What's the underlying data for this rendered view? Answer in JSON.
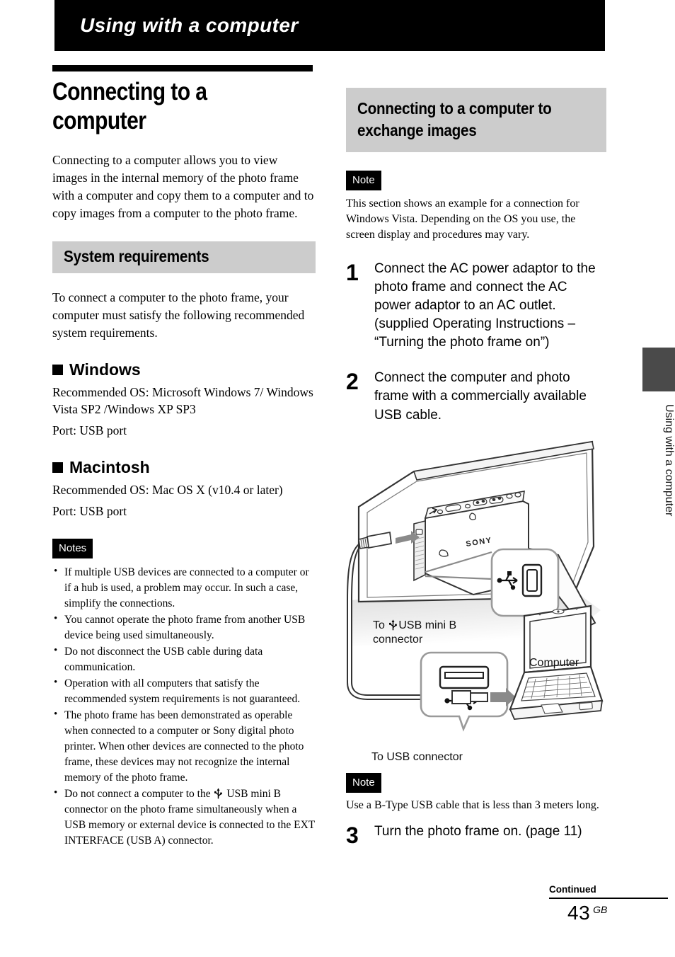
{
  "chapter": {
    "bar_title": "Using with a computer"
  },
  "left_column": {
    "article_title": "Connecting to a computer",
    "intro_paragraph": "Connecting to a computer allows you to view images in the internal memory of the photo frame with a computer and copy them to a computer and to copy images from a computer to the photo frame.",
    "system_requirements": {
      "heading": "System requirements",
      "intro": "To connect a computer to the photo frame, your computer must satisfy the following recommended system requirements.",
      "windows": {
        "heading": "Windows",
        "os_line": "Recommended OS: Microsoft Windows 7/ Windows Vista SP2 /Windows XP SP3",
        "port_line": "Port: USB port"
      },
      "macintosh": {
        "heading": "Macintosh",
        "os_line": "Recommended OS: Mac OS X (v10.4 or later)",
        "port_line": "Port: USB port"
      }
    },
    "notes": {
      "label": "Notes",
      "items": [
        {
          "text": "If multiple USB devices are connected to a computer or if a hub is used, a problem may occur. In such a case, simplify the connections."
        },
        {
          "text": "You cannot operate the photo frame from another USB device being used simultaneously."
        },
        {
          "text": "Do not disconnect the USB cable during data communication."
        },
        {
          "text": "Operation with all computers that satisfy the recommended system requirements is not guaranteed."
        },
        {
          "text": "The photo frame has been demonstrated as operable when connected to a computer or Sony digital photo printer. When other devices are connected to the photo frame, these devices may not recognize the internal memory of the photo frame."
        },
        {
          "text_before_icon": "Do not connect a computer to the ",
          "icon": "usb-trident-icon",
          "text_after_icon": " USB mini B connector on the photo frame simultaneously when a USB memory or external device is connected to the EXT INTERFACE (USB A) connector."
        }
      ]
    }
  },
  "right_column": {
    "section_heading": "Connecting to a computer to exchange images",
    "top_note": {
      "label": "Note",
      "body": "This section shows an example for a connection for Windows Vista. Depending on the OS you use, the screen display and procedures may vary."
    },
    "steps": [
      {
        "number": "1",
        "text": "Connect the AC power adaptor to the photo frame and connect the AC power adaptor to an AC outlet. (supplied Operating Instructions – “Turning the photo frame on”)"
      },
      {
        "number": "2",
        "text": "Connect the computer and photo frame with a commercially available USB cable."
      },
      {
        "number": "3",
        "text": "Turn the photo frame on. (page 11)"
      }
    ],
    "diagram": {
      "label_mini_b_before": "To ",
      "label_mini_b_icon": "usb-trident-icon",
      "label_mini_b_after": "USB mini B",
      "label_mini_b_line2": "connector",
      "label_usb_connector": "To USB connector",
      "label_computer": "Computer",
      "brand_on_frame": "SONY"
    },
    "bottom_note": {
      "label": "Note",
      "body": "Use a B-Type USB cable that is less than 3 meters long."
    }
  },
  "edge_tab": {
    "text": "Using with a computer",
    "color": "#4a4a4a"
  },
  "footer": {
    "continued": "Continued",
    "page_number": "43",
    "region_code": "GB"
  },
  "colors": {
    "chapter_bar": "#000000",
    "gray_heading": "#cccccc",
    "note_label": "#000000"
  }
}
